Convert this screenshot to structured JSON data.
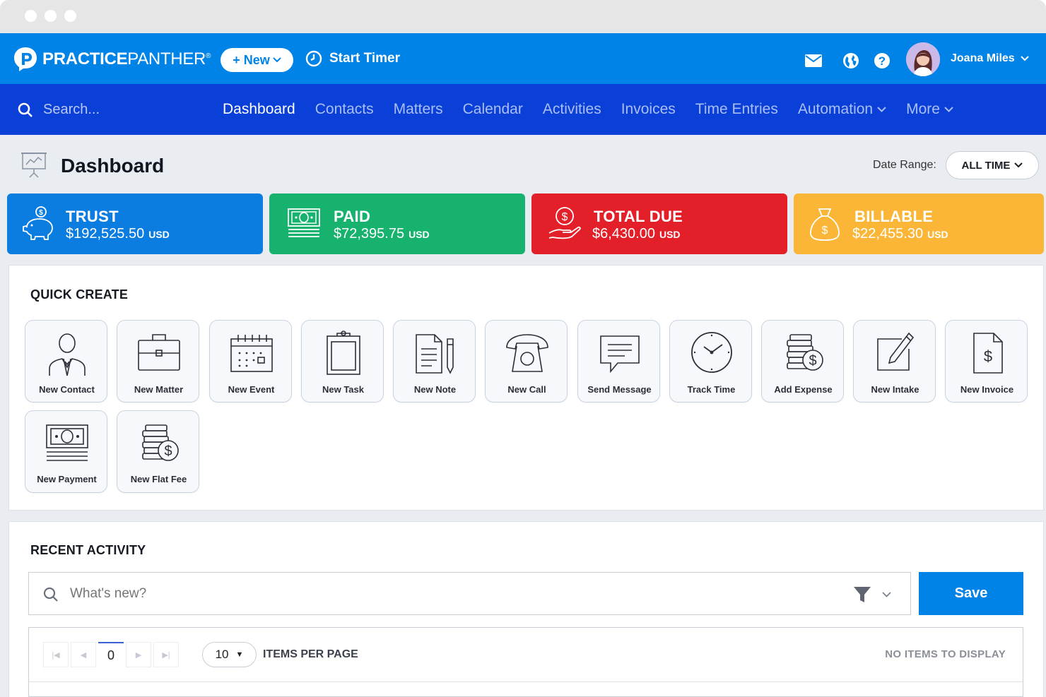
{
  "topbar": {
    "brand_bold": "PRACTICE",
    "brand_light": "PANTHER",
    "brand_mark": "®",
    "new_label": "+ New",
    "timer_label": "Start Timer",
    "user_name": "Joana Miles"
  },
  "search": {
    "placeholder": "Search..."
  },
  "nav": [
    {
      "label": "Dashboard"
    },
    {
      "label": "Contacts"
    },
    {
      "label": "Matters"
    },
    {
      "label": "Calendar"
    },
    {
      "label": "Activities"
    },
    {
      "label": "Invoices"
    },
    {
      "label": "Time Entries"
    },
    {
      "label": "Automation"
    },
    {
      "label": "More"
    }
  ],
  "page": {
    "title": "Dashboard",
    "date_range_label": "Date Range:",
    "date_range_value": "ALL TIME"
  },
  "cards": [
    {
      "label": "TRUST",
      "amount": "$192,525.50",
      "currency": "USD",
      "color": "#0c7de0"
    },
    {
      "label": "PAID",
      "amount": "$72,395.75",
      "currency": "USD",
      "color": "#17b26d"
    },
    {
      "label": "TOTAL DUE",
      "amount": "$6,430.00",
      "currency": "USD",
      "color": "#e32029"
    },
    {
      "label": "BILLABLE",
      "amount": "$22,455.30",
      "currency": "USD",
      "color": "#fbb637"
    }
  ],
  "quick_create": {
    "title": "QUICK CREATE",
    "items": [
      {
        "label": "New Contact",
        "icon": "contact-icon"
      },
      {
        "label": "New Matter",
        "icon": "briefcase-icon"
      },
      {
        "label": "New Event",
        "icon": "calendar-icon"
      },
      {
        "label": "New Task",
        "icon": "clipboard-icon"
      },
      {
        "label": "New Note",
        "icon": "note-icon"
      },
      {
        "label": "New Call",
        "icon": "phone-icon"
      },
      {
        "label": "Send Message",
        "icon": "message-icon"
      },
      {
        "label": "Track Time",
        "icon": "clock-icon"
      },
      {
        "label": "Add Expense",
        "icon": "expense-icon"
      },
      {
        "label": "New Intake",
        "icon": "intake-icon"
      },
      {
        "label": "New Invoice",
        "icon": "invoice-icon"
      },
      {
        "label": "New Payment",
        "icon": "payment-icon"
      },
      {
        "label": "New Flat Fee",
        "icon": "flat-fee-icon"
      }
    ]
  },
  "recent_activity": {
    "title": "RECENT ACTIVITY",
    "placeholder": "What's new?",
    "save_label": "Save",
    "page_number": "0",
    "per_page": "10",
    "per_page_label": "ITEMS PER PAGE",
    "empty_label": "NO ITEMS TO DISPLAY"
  }
}
